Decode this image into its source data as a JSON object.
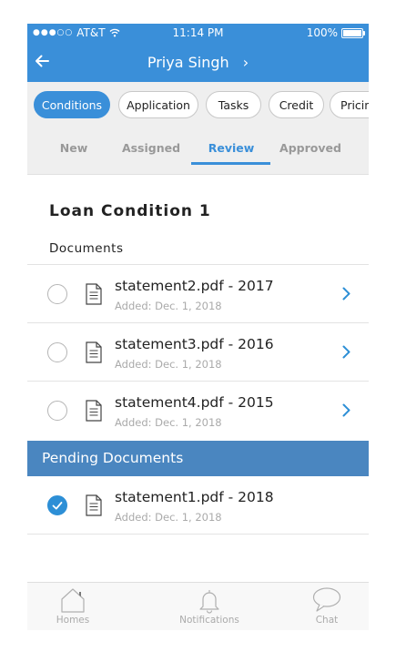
{
  "status": {
    "carrier": "AT&T",
    "signal_dots": "●●●○○",
    "time": "11:14 PM",
    "battery": "100%",
    "battery_level": 1.0
  },
  "header": {
    "title": "Priya Singh"
  },
  "chips": [
    "Conditions",
    "Application",
    "Tasks",
    "Credit",
    "Pricin"
  ],
  "subtabs": [
    "New",
    "Assigned",
    "Review",
    "Approved"
  ],
  "condition_title": "Loan Condition 1",
  "documents_header": "Documents",
  "documents": [
    {
      "name": "statement2.pdf - 2017",
      "added": "Added: Dec. 1, 2018"
    },
    {
      "name": "statement3.pdf - 2016",
      "added": "Added: Dec. 1, 2018"
    },
    {
      "name": "statement4.pdf - 2015",
      "added": "Added: Dec. 1, 2018"
    }
  ],
  "pending_header": "Pending Documents",
  "pending": [
    {
      "name": "statement1.pdf - 2018",
      "added": "Added: Dec. 1, 2018"
    }
  ],
  "tabbar": [
    "Homes",
    "Notifications",
    "Chat"
  ],
  "colors": {
    "primary": "#3a8fd9",
    "pending_bar": "#4a86c0"
  }
}
